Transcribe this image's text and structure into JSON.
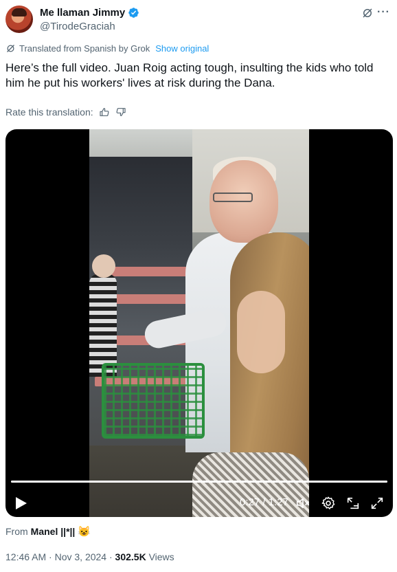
{
  "author": {
    "display_name": "Me llaman Jimmy",
    "handle": "@TirodeGraciah",
    "verified": true
  },
  "translation": {
    "notice": "Translated from Spanish by Grok",
    "show_original": "Show original",
    "rate_label": "Rate this translation:"
  },
  "tweet": {
    "text": "Here’s the full video. Juan Roig acting tough, insulting the kids who told him he put his workers' lives at risk during the Dana."
  },
  "video": {
    "time": "0:27 / 1:27",
    "progress": 1.0,
    "controls": [
      "play-icon",
      "mute-icon",
      "settings-icon",
      "picture-in-picture-icon",
      "fullscreen-icon"
    ]
  },
  "source": {
    "from_label": "From",
    "name": "Manel ||*||",
    "emoji": "😺"
  },
  "meta": {
    "timestamp": "12:46 AM · Nov 3, 2024 · ",
    "views_count": "302.5K",
    "views_label": " Views"
  },
  "colors": {
    "accent": "#1d9bf0",
    "text": "#0f1419",
    "secondary": "#536471"
  }
}
